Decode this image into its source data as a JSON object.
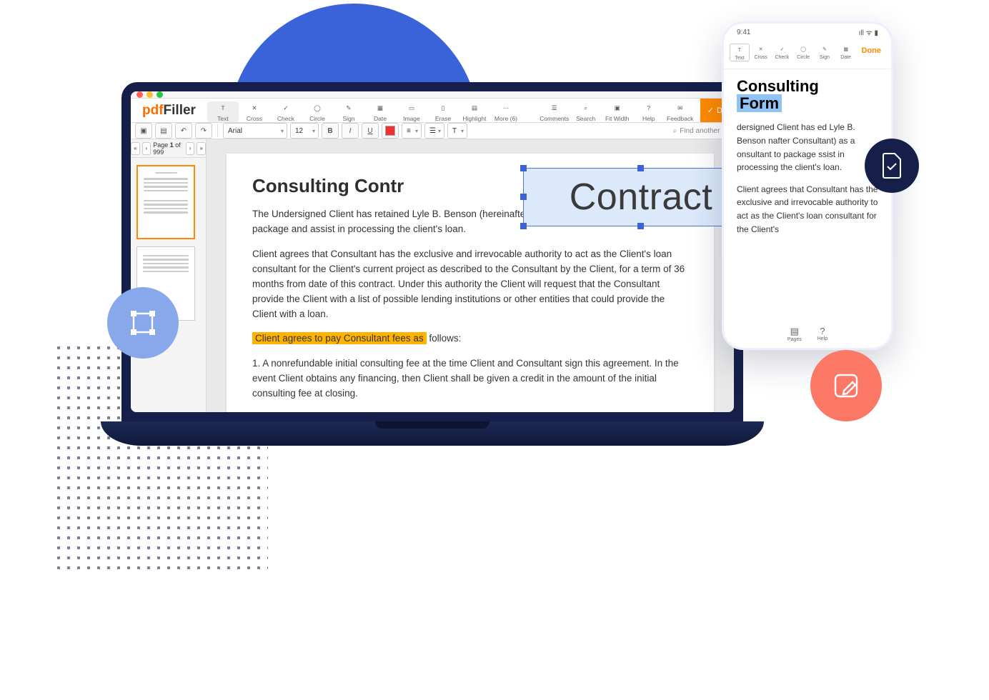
{
  "logo": {
    "prefix": "pdf",
    "suffix": "Filler"
  },
  "toolbar": [
    {
      "label": "Text",
      "ico": "T"
    },
    {
      "label": "Cross",
      "ico": "✕"
    },
    {
      "label": "Check",
      "ico": "✓"
    },
    {
      "label": "Circle",
      "ico": "◯"
    },
    {
      "label": "Sign",
      "ico": "✎"
    },
    {
      "label": "Date",
      "ico": "▦"
    },
    {
      "label": "Image",
      "ico": "▭"
    },
    {
      "label": "Erase",
      "ico": "▯"
    },
    {
      "label": "Highlight",
      "ico": "▤"
    },
    {
      "label": "More (6)",
      "ico": "⋯"
    }
  ],
  "toolbar_right": [
    {
      "label": "Comments",
      "ico": "☰"
    },
    {
      "label": "Search",
      "ico": "⌕"
    },
    {
      "label": "Fit Width",
      "ico": "▣"
    },
    {
      "label": "Help",
      "ico": "?"
    },
    {
      "label": "Feedback",
      "ico": "✉"
    }
  ],
  "done_label": "Do",
  "font": {
    "family": "Arial",
    "size": "12"
  },
  "search_placeholder": "Find another f",
  "page_nav": {
    "label_pre": "Page ",
    "current": "1",
    "label_mid": " of ",
    "total": "999"
  },
  "doc": {
    "title": "Consulting Contr",
    "p1": "The Undersigned Client has retained Lyle B. Benson (hereinafter Consultant) as a loan consultant to package and assist in processing the client's loan.",
    "p2": "Client agrees that Consultant has the exclusive and irrevocable authority to act as the Client's loan consultant for the Client's current project as described to the Consultant by the Client, for a term of 36 months from date of this contract. Under this authority the Client will request that the Consultant provide the Client with a list of possible lending institutions or other entities that could provide the Client with a loan.",
    "hl": "Client agrees to pay Consultant fees as",
    "after_hl": "  follows:",
    "p3": "1. A nonrefundable initial consulting fee at the time Client and Consultant sign this agreement. In the event Client obtains any financing, then Client shall be given a credit in the amount of the initial consulting fee at closing."
  },
  "contract_text": "Contract",
  "phone": {
    "time": "9:41",
    "tools": [
      {
        "label": "Text",
        "ico": "T"
      },
      {
        "label": "Cross",
        "ico": "✕"
      },
      {
        "label": "Check",
        "ico": "✓"
      },
      {
        "label": "Circle",
        "ico": "◯"
      },
      {
        "label": "Sign",
        "ico": "✎"
      },
      {
        "label": "Date",
        "ico": "▦"
      }
    ],
    "done": "Done",
    "title_l1": "Consulting",
    "title_l2": "Form",
    "p1": "       dersigned Client has      ed Lyle B. Benson       nafter Consultant) as a      onsultant to package        ssist in processing the client's loan.",
    "p2": "Client  agrees that Consultant has the exclusive and irrevocable authority to act as the Client's loan consultant for the Client's",
    "bottom": [
      {
        "label": "Pages",
        "ico": "▤"
      },
      {
        "label": "Help",
        "ico": "?"
      }
    ]
  }
}
